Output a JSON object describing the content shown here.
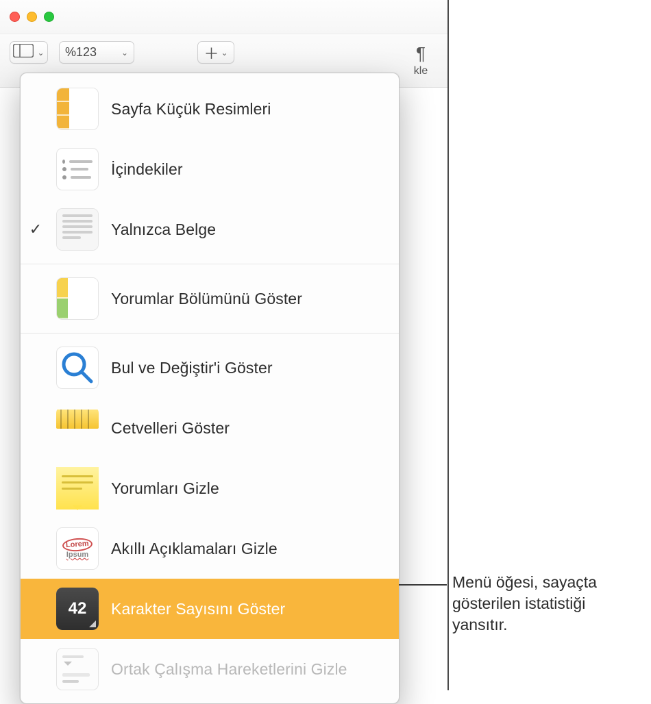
{
  "window": {
    "traffic": {
      "close": "#ff5f57",
      "min": "#febc2e",
      "max": "#28c840"
    }
  },
  "toolbar": {
    "zoom_label": "%123",
    "format_text": "kle"
  },
  "menu": {
    "items": [
      {
        "label": "Sayfa Küçük Resimleri",
        "icon": "thumbnails-icon",
        "checked": false,
        "highlight": false,
        "disabled": false
      },
      {
        "label": "İçindekiler",
        "icon": "toc-icon",
        "checked": false,
        "highlight": false,
        "disabled": false
      },
      {
        "label": "Yalnızca Belge",
        "icon": "document-only-icon",
        "checked": true,
        "highlight": false,
        "disabled": false
      }
    ],
    "items2": [
      {
        "label": "Yorumlar Bölümünü Göster",
        "icon": "comments-pane-icon",
        "checked": false,
        "highlight": false,
        "disabled": false
      }
    ],
    "items3": [
      {
        "label": "Bul ve Değiştir'i Göster",
        "icon": "search-icon",
        "checked": false,
        "highlight": false,
        "disabled": false
      },
      {
        "label": "Cetvelleri Göster",
        "icon": "ruler-icon",
        "checked": false,
        "highlight": false,
        "disabled": false
      },
      {
        "label": "Yorumları Gizle",
        "icon": "note-icon",
        "checked": false,
        "highlight": false,
        "disabled": false
      },
      {
        "label": "Akıllı Açıklamaları Gizle",
        "icon": "lorem-icon",
        "checked": false,
        "highlight": false,
        "disabled": false
      },
      {
        "label": "Karakter Sayısını Göster",
        "icon": "count-icon",
        "count_value": "42",
        "checked": false,
        "highlight": true,
        "disabled": false
      },
      {
        "label": "Ortak Çalışma Hareketlerini Gizle",
        "icon": "collab-icon",
        "checked": false,
        "highlight": false,
        "disabled": true
      }
    ]
  },
  "callout": {
    "text": "Menü öğesi, sayaçta gösterilen istatistiği yansıtır."
  }
}
